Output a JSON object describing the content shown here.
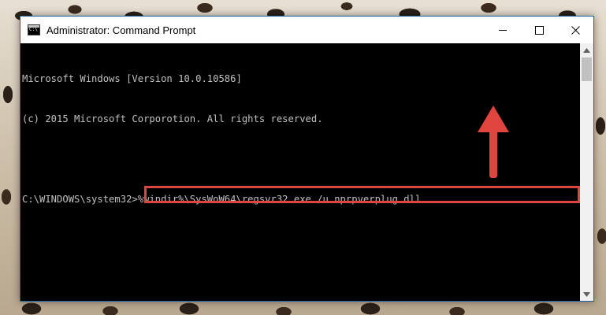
{
  "window": {
    "title": "Administrator: Command Prompt",
    "icon": "cmd-app-icon",
    "controls": {
      "minimize": "minimize-icon",
      "maximize": "maximize-icon",
      "close": "close-icon"
    }
  },
  "console": {
    "lines": [
      "Microsoft Windows [Version 10.0.10586]",
      "(c) 2015 Microsoft Corporotion. All rights reserved.",
      ""
    ],
    "prompt": "C:\\WINDOWS\\system32>",
    "command": "%windir%\\SysWoW64\\regsvr32.exe /u nprpverplug.dll"
  },
  "colors": {
    "console_bg": "#000000",
    "console_text": "#c0c0c0",
    "highlight": "#e0443e",
    "arrow": "#e0443e"
  }
}
